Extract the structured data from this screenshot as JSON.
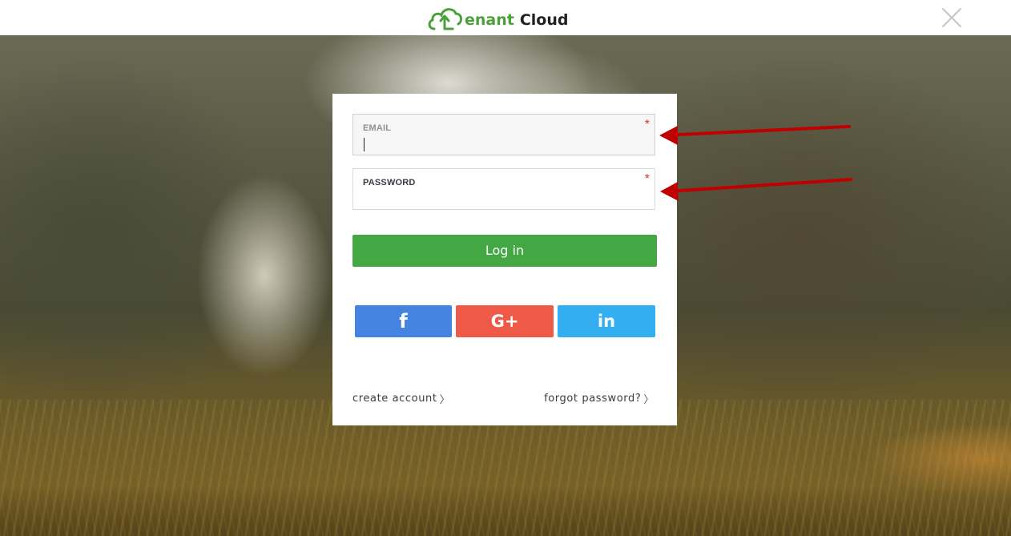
{
  "header": {
    "logo_letter": "t",
    "logo_word1": "enant",
    "logo_word2": "Cloud",
    "brand_color": "#4aa03a",
    "close_icon": "close-icon"
  },
  "form": {
    "email": {
      "label": "EMAIL",
      "required_mark": "*",
      "value": ""
    },
    "password": {
      "label": "PASSWORD",
      "required_mark": "*",
      "value": ""
    },
    "login_label": "Log in",
    "social": {
      "facebook": {
        "glyph": "f",
        "color": "#4583e0"
      },
      "google": {
        "glyph": "G+",
        "color": "#ee5a47"
      },
      "linkedin": {
        "glyph": "in",
        "color": "#33aef0"
      }
    },
    "create_account": "create account",
    "forgot_password": "forgot password?",
    "accent_color": "#43a843",
    "required_color": "#d8343d",
    "annotation_arrow_color": "#c00000"
  }
}
